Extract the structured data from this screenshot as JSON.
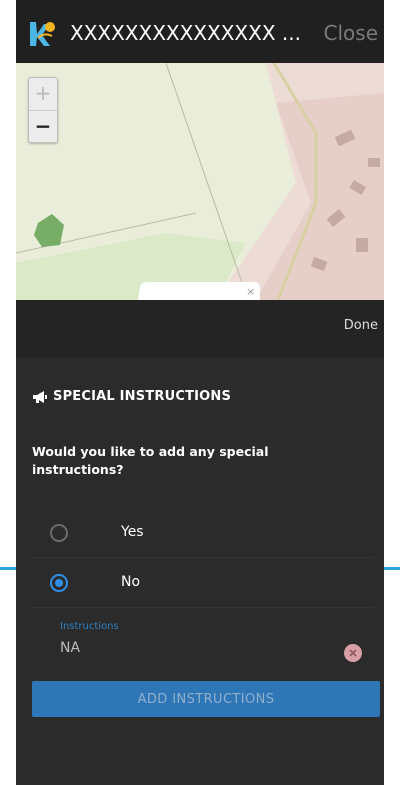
{
  "header": {
    "title": "XXXXXXXXXXXXXXX ...",
    "close_label": "Close",
    "logo_icon": "kdp-logo-icon"
  },
  "map": {
    "zoom_in_label": "+",
    "zoom_out_label": "−"
  },
  "toolbar": {
    "done_label": "Done"
  },
  "form": {
    "section_title": "SPECIAL INSTRUCTIONS",
    "section_icon": "megaphone-icon",
    "question": "Would you like to add any special instructions?",
    "options": [
      {
        "label": "Yes",
        "selected": false
      },
      {
        "label": "No",
        "selected": true
      }
    ],
    "instructions_label": "Instructions",
    "instructions_value": "NA",
    "submit_label": "ADD INSTRUCTIONS"
  },
  "colors": {
    "accent": "#2f8fe8",
    "button": "#2f76b6",
    "background": "#2b2b2b"
  }
}
